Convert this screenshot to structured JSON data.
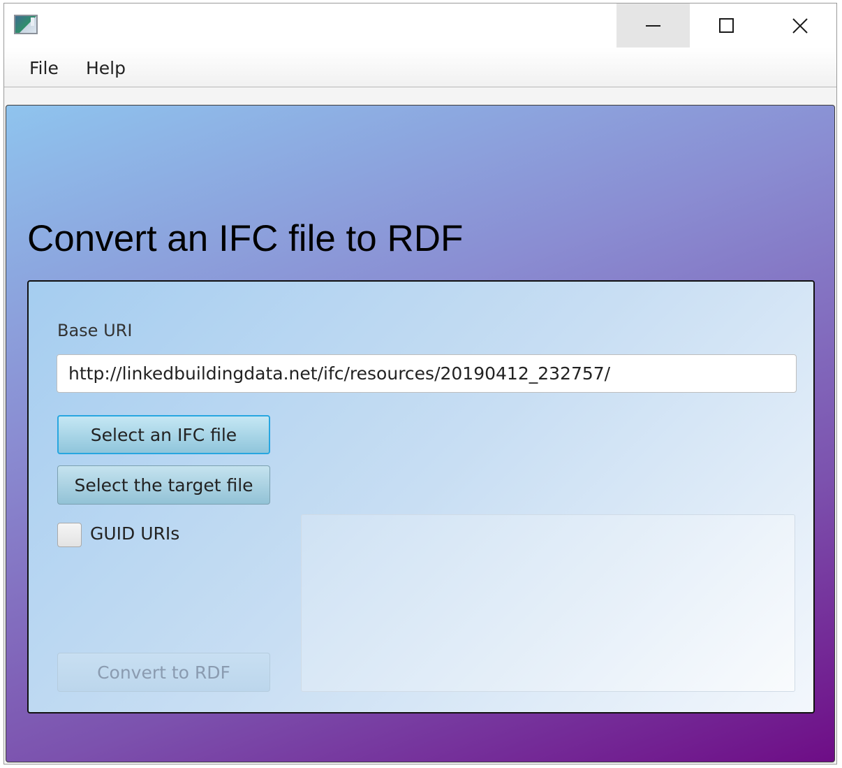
{
  "window": {
    "minimize_label": "",
    "maximize_label": "",
    "close_label": ""
  },
  "menubar": {
    "items": [
      "File",
      "Help"
    ]
  },
  "main": {
    "title": "Convert an IFC file to RDF",
    "base_uri_label": "Base URI",
    "base_uri_value": "http://linkedbuildingdata.net/ifc/resources/20190412_232757/",
    "select_ifc_button": "Select an IFC file",
    "select_target_button": "Select the target file",
    "guid_checkbox_label": "GUID URIs",
    "guid_checked": false,
    "convert_button": "Convert to RDF",
    "convert_enabled": false,
    "log_text": ""
  },
  "colors": {
    "gradient_start": "#8fc4ee",
    "gradient_end": "#6e0d86",
    "focus_accent": "#27a6e0"
  }
}
